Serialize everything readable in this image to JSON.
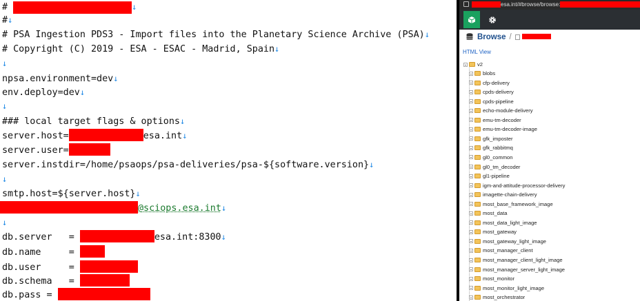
{
  "editor": {
    "lines": [
      {
        "text": "# ",
        "redacted_width": 168,
        "suffix": ""
      },
      {
        "text": "#",
        "suffix": ""
      },
      {
        "text": "# PSA Ingestion PDS3 - Import files into the Planetary Science Archive (PSA)"
      },
      {
        "text": "# Copyright (C) 2019 - ESA - ESAC - Madrid, Spain"
      },
      {
        "text": ""
      },
      {
        "text": "npsa.environment=dev"
      },
      {
        "text": "env.deploy=dev"
      },
      {
        "text": ""
      },
      {
        "text": "### local target flags & options"
      },
      {
        "prefix": "server.host=",
        "suffix": "esa.int"
      },
      {
        "prefix": "server.user=",
        "suffix": ""
      },
      {
        "text": "server.instdir=/home/psaops/psa-deliveries/psa-${software.version}"
      },
      {
        "text": ""
      },
      {
        "text": "smtp.host=${server.host}"
      },
      {
        "prefix": "",
        "suffix_green": "@sciops.esa.int"
      },
      {
        "text": ""
      },
      {
        "prefix": "db.server   = ",
        "suffix": "esa.int:8300"
      },
      {
        "prefix": "db.name     = ",
        "suffix": ""
      },
      {
        "prefix": "db.user     = ",
        "suffix": ""
      },
      {
        "prefix": "db.schema   = ",
        "suffix": ""
      },
      {
        "prefix": "db.pass = ",
        "suffix": ""
      }
    ],
    "newline_glyph": "↓"
  },
  "browser": {
    "url_suffix": "esa.int/#browse/browse:",
    "breadcrumb_label": "Browse",
    "breadcrumb_sep": "/",
    "html_view_label": "HTML View",
    "tree_root": "v2",
    "tree_items": [
      "blobs",
      "cfp-delivery",
      "cpds-delivery",
      "cpds-pipeline",
      "echo-module-delivery",
      "emu-tm-decoder",
      "emu-tm-decoder-image",
      "gfk_imposter",
      "gfk_rabbitmq",
      "gl0_common",
      "gl0_tm_decoder",
      "gl1-pipeline",
      "igm-and-attitude-processor-delivery",
      "imagette-chain-delivery",
      "most_base_framework_image",
      "most_data",
      "most_data_light_image",
      "most_gateway",
      "most_gateway_light_image",
      "most_manager_client",
      "most_manager_client_light_image",
      "most_manager_server_light_image",
      "most_monitor",
      "most_monitor_light_image",
      "most_orchestrator"
    ],
    "icons": {
      "tab_cube": "cube-icon",
      "tab_gear": "gear-icon",
      "database": "database-icon",
      "lock": "lock-icon",
      "folder": "folder-icon"
    },
    "accent": "#1aa15f"
  }
}
